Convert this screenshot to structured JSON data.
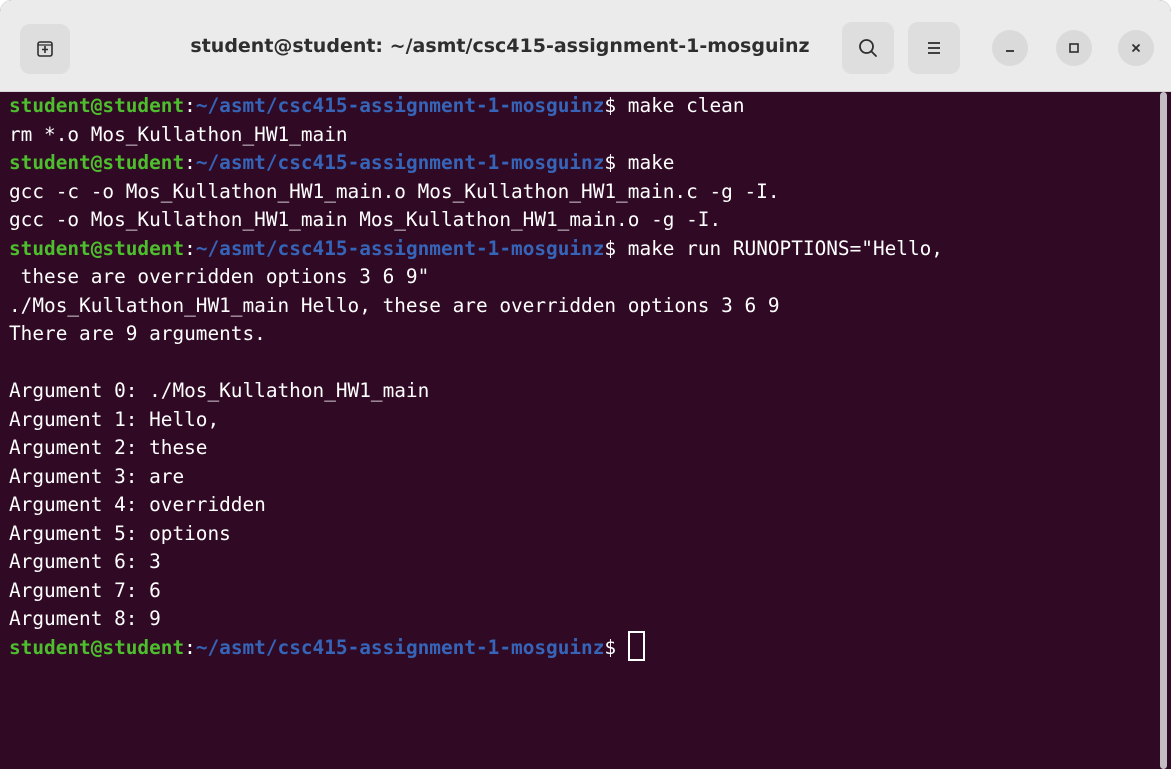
{
  "window": {
    "title": "student@student: ~/asmt/csc415-assignment-1-mosguinz"
  },
  "titlebar": {
    "new_tab_icon": "new-tab-icon",
    "search_icon": "search-icon",
    "menu_icon": "hamburger-menu-icon",
    "minimize_icon": "minimize-icon",
    "maximize_icon": "maximize-icon",
    "close_icon": "close-icon"
  },
  "prompt": {
    "user_host": "student@student",
    "colon": ":",
    "path": "~/asmt/csc415-assignment-1-mosguinz",
    "dollar": "$ "
  },
  "commands": {
    "cmd1": "make clean",
    "cmd2": "make",
    "cmd3": "make run RUNOPTIONS=\"Hello,"
  },
  "output": {
    "out1": "rm *.o Mos_Kullathon_HW1_main",
    "out2": "gcc -c -o Mos_Kullathon_HW1_main.o Mos_Kullathon_HW1_main.c -g -I.",
    "out3": "gcc -o Mos_Kullathon_HW1_main Mos_Kullathon_HW1_main.o -g -I.",
    "out4": " these are overridden options 3 6 9\"",
    "out5": "./Mos_Kullathon_HW1_main Hello, these are overridden options 3 6 9",
    "out6": "There are 9 arguments.",
    "out7": "",
    "args": [
      "Argument 0: ./Mos_Kullathon_HW1_main",
      "Argument 1: Hello,",
      "Argument 2: these",
      "Argument 3: are",
      "Argument 4: overridden",
      "Argument 5: options",
      "Argument 6: 3",
      "Argument 7: 6",
      "Argument 8: 9"
    ]
  },
  "colors": {
    "background": "#300a24",
    "user_host": "#4dbe2d",
    "path": "#3564b8",
    "text": "#ffffff",
    "titlebar": "#ebebeb"
  }
}
